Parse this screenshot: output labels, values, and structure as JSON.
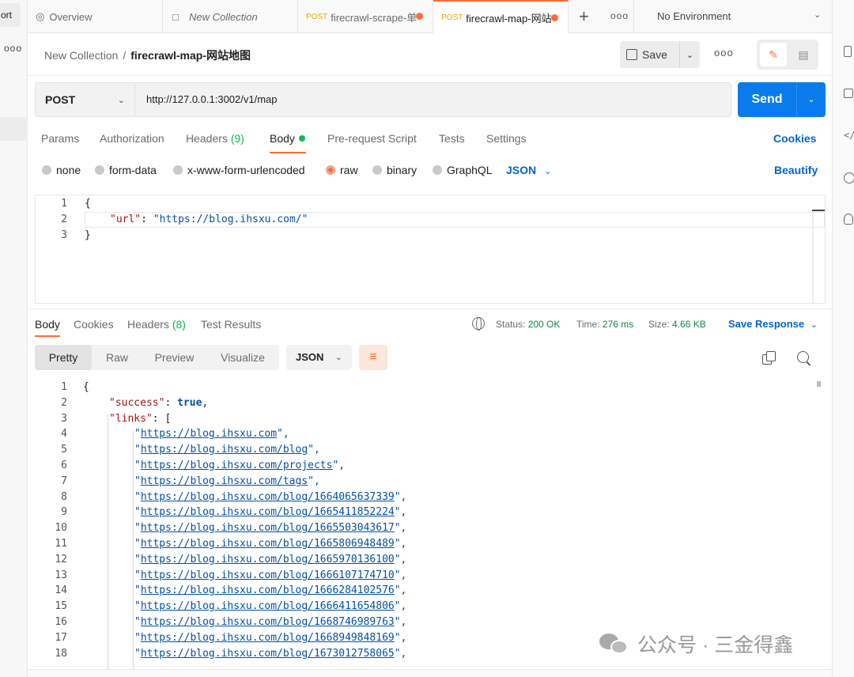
{
  "sidebar": {
    "import_label": "ort",
    "more": "ooo"
  },
  "tabs": [
    {
      "label": "Overview",
      "icon": "overview-icon"
    },
    {
      "label": "New Collection",
      "icon": "collection-icon"
    },
    {
      "method": "POST",
      "label": "firecrawl-scrape-单",
      "unsaved": true
    },
    {
      "method": "POST",
      "label": "firecrawl-map-网站",
      "unsaved": true,
      "active": true
    }
  ],
  "tabbar": {
    "add": "+",
    "more": "ooo",
    "environment": "No Environment"
  },
  "breadcrumb": {
    "parent": "New Collection",
    "separator": "/",
    "current": "firecrawl-map-网站地图"
  },
  "toolbar": {
    "save_label": "Save",
    "more": "ooo"
  },
  "request": {
    "method": "POST",
    "url": "http://127.0.0.1:3002/v1/map",
    "send_label": "Send",
    "tabs": {
      "params": "Params",
      "authorization": "Authorization",
      "headers": "Headers",
      "headers_count": "(9)",
      "body": "Body",
      "prerequest": "Pre-request Script",
      "tests": "Tests",
      "settings": "Settings"
    },
    "cookies_link": "Cookies",
    "body_types": {
      "none": "none",
      "form_data": "form-data",
      "urlencoded": "x-www-form-urlencoded",
      "raw": "raw",
      "binary": "binary",
      "graphql": "GraphQL"
    },
    "body_format": "JSON",
    "beautify": "Beautify",
    "body_lines": [
      {
        "n": "1",
        "text": "{"
      },
      {
        "n": "2",
        "key": "\"url\"",
        "colon": ": ",
        "value": "\"https://blog.ihsxu.com/\""
      },
      {
        "n": "3",
        "text": "}"
      }
    ]
  },
  "response": {
    "tabs": {
      "body": "Body",
      "cookies": "Cookies",
      "headers": "Headers",
      "headers_count": "(8)",
      "test_results": "Test Results"
    },
    "status_label": "Status:",
    "status_value": "200 OK",
    "time_label": "Time:",
    "time_value": "276 ms",
    "size_label": "Size:",
    "size_value": "4.66 KB",
    "save_response": "Save Response",
    "views": {
      "pretty": "Pretty",
      "raw": "Raw",
      "preview": "Preview",
      "visualize": "Visualize"
    },
    "format": "JSON",
    "success_key": "\"success\"",
    "success_value": "true",
    "links_key": "\"links\"",
    "links": [
      "https://blog.ihsxu.com",
      "https://blog.ihsxu.com/blog",
      "https://blog.ihsxu.com/projects",
      "https://blog.ihsxu.com/tags",
      "https://blog.ihsxu.com/blog/1664065637339",
      "https://blog.ihsxu.com/blog/1665411852224",
      "https://blog.ihsxu.com/blog/1665503043617",
      "https://blog.ihsxu.com/blog/1665806948489",
      "https://blog.ihsxu.com/blog/1665970136100",
      "https://blog.ihsxu.com/blog/1666107174710",
      "https://blog.ihsxu.com/blog/1666284102576",
      "https://blog.ihsxu.com/blog/1666411654806",
      "https://blog.ihsxu.com/blog/1668746989763",
      "https://blog.ihsxu.com/blog/1668949848169",
      "https://blog.ihsxu.com/blog/1673012758065"
    ]
  },
  "watermark": "公众号 · 三金得鑫",
  "colors": {
    "accent": "#ff6c37",
    "send": "#097bed",
    "link": "#0265d2",
    "ok": "#0cbb52"
  }
}
